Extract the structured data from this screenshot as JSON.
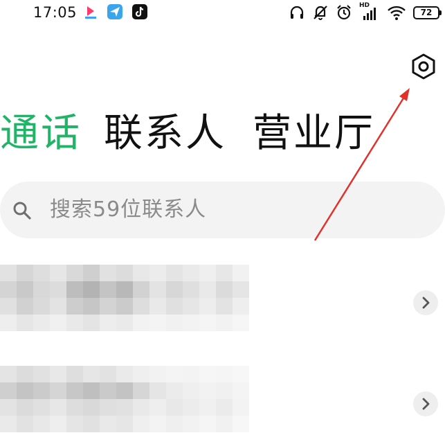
{
  "status_bar": {
    "time": "17:05",
    "battery": "72",
    "signal_label": "HD",
    "app_icons": [
      "video-app-icon",
      "messenger-app-icon",
      "tiktok-app-icon"
    ],
    "status_icons": [
      "headphones-icon",
      "mute-icon",
      "alarm-icon",
      "signal-icon",
      "wifi-icon",
      "battery-icon"
    ]
  },
  "header": {
    "settings_icon": "settings-hexagon-icon"
  },
  "tabs": [
    {
      "label": "通话",
      "active": true
    },
    {
      "label": "联系人",
      "active": false
    },
    {
      "label": "营业厅",
      "active": false
    }
  ],
  "search": {
    "placeholder": "搜索59位联系人"
  },
  "list": {
    "items": [
      {
        "name_obscured": true,
        "chevron_icon": "chevron-right-icon"
      },
      {
        "name_obscured": true,
        "chevron_icon": "chevron-right-icon"
      }
    ]
  },
  "colors": {
    "accent": "#22b268",
    "text": "#111111",
    "placeholder": "#8a8a8a",
    "search_background": "#f3f3f3",
    "annotation_arrow": "#e0312b"
  }
}
